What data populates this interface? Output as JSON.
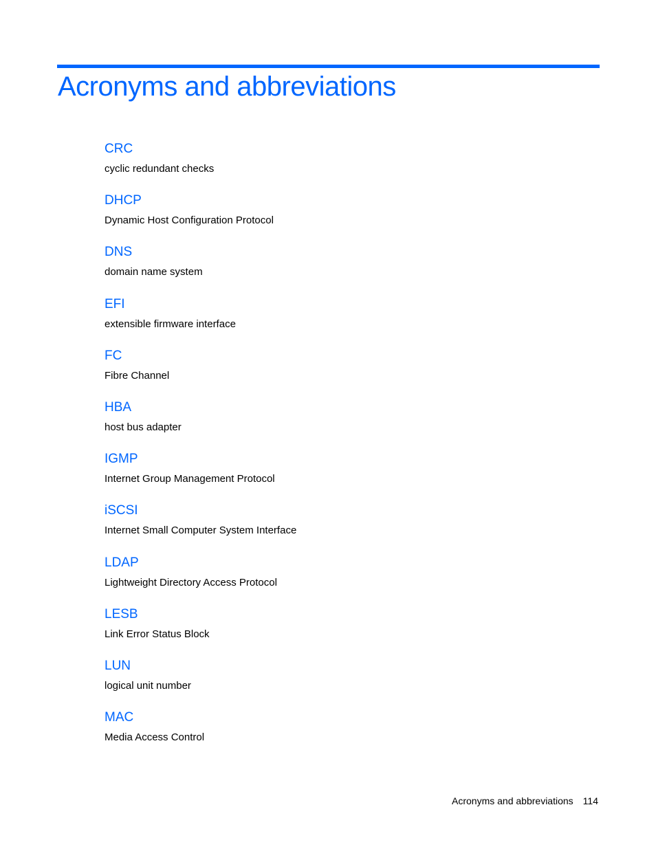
{
  "page": {
    "title": "Acronyms and abbreviations",
    "entries": [
      {
        "term": "CRC",
        "definition": "cyclic redundant checks"
      },
      {
        "term": "DHCP",
        "definition": "Dynamic Host Configuration Protocol"
      },
      {
        "term": "DNS",
        "definition": "domain name system"
      },
      {
        "term": "EFI",
        "definition": "extensible firmware interface"
      },
      {
        "term": "FC",
        "definition": "Fibre Channel"
      },
      {
        "term": "HBA",
        "definition": "host bus adapter"
      },
      {
        "term": "IGMP",
        "definition": "Internet Group Management Protocol"
      },
      {
        "term": "iSCSI",
        "definition": "Internet Small Computer System Interface"
      },
      {
        "term": "LDAP",
        "definition": "Lightweight Directory Access Protocol"
      },
      {
        "term": "LESB",
        "definition": "Link Error Status Block"
      },
      {
        "term": "LUN",
        "definition": "logical unit number"
      },
      {
        "term": "MAC",
        "definition": "Media Access Control"
      }
    ]
  },
  "footer": {
    "section": "Acronyms and abbreviations",
    "page_number": "114"
  },
  "colors": {
    "accent": "#0066ff"
  }
}
